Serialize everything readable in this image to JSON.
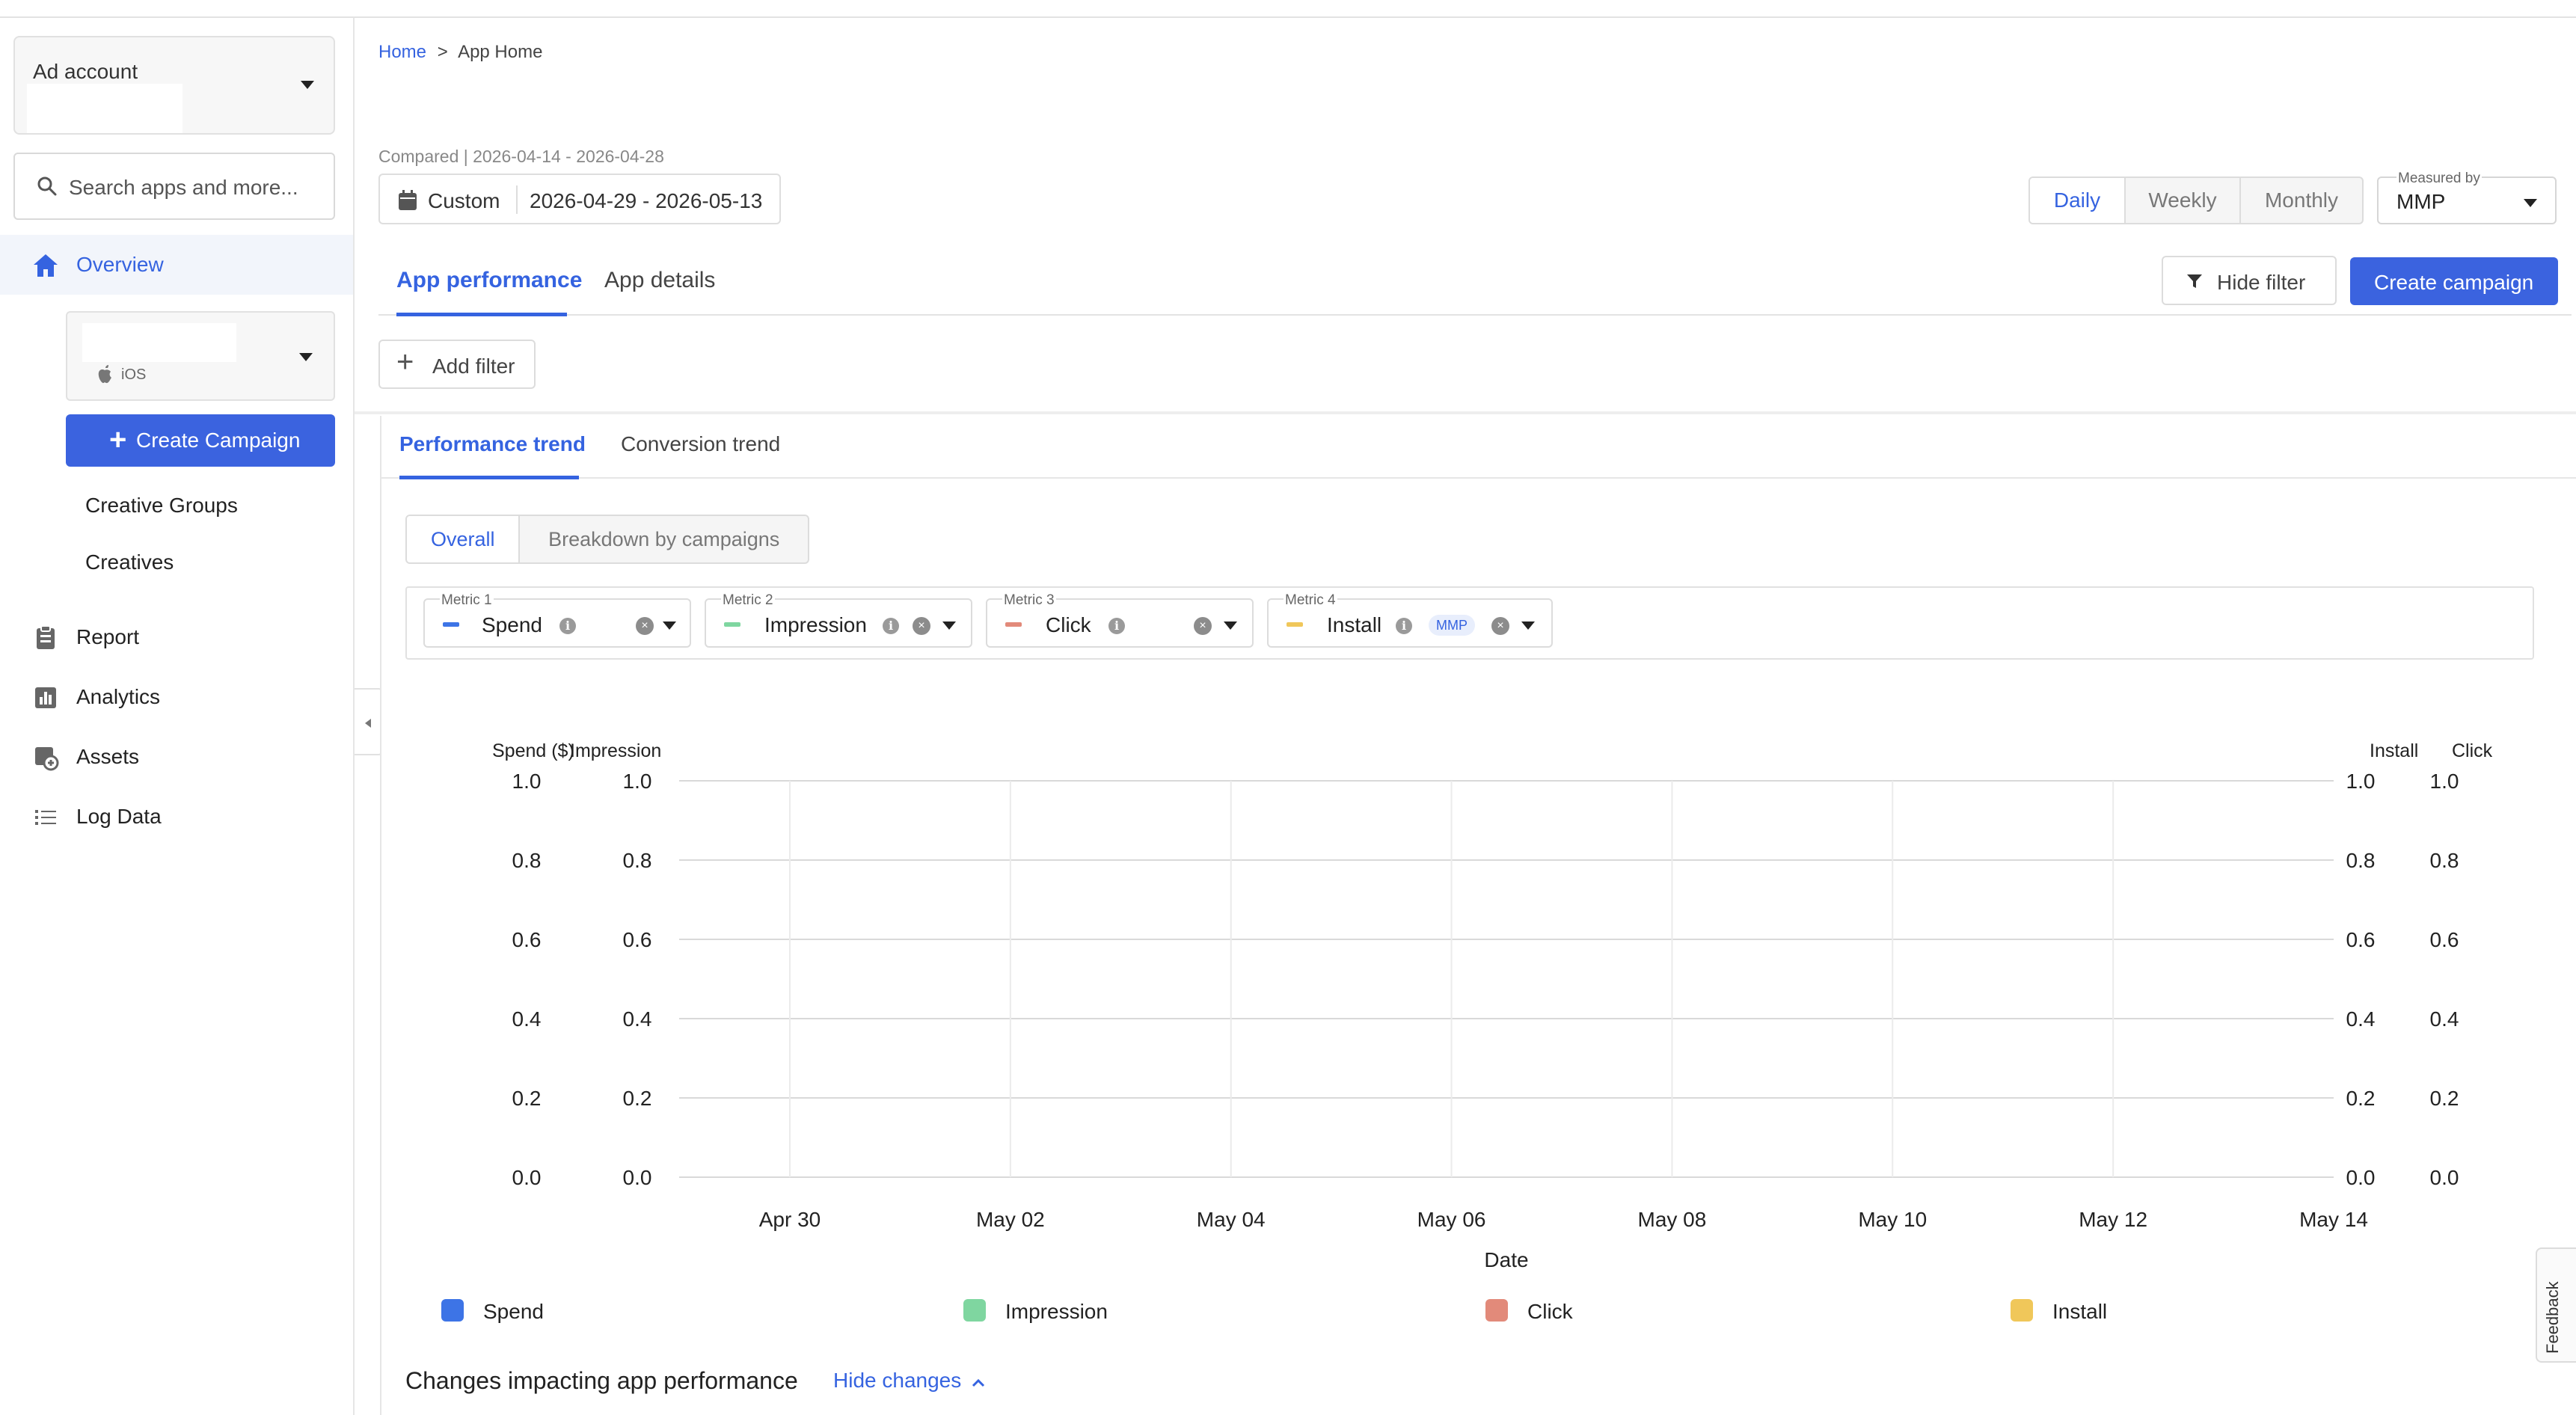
{
  "sidebar": {
    "ad_account_label": "Ad account",
    "search_placeholder": "Search apps and more...",
    "overview_label": "Overview",
    "app_platform": "iOS",
    "create_campaign_label": "Create Campaign",
    "sub_items": [
      "Creative Groups",
      "Creatives"
    ],
    "nav": [
      "Report",
      "Analytics",
      "Assets",
      "Log Data"
    ]
  },
  "breadcrumb": {
    "home": "Home",
    "separator": ">",
    "current": "App Home"
  },
  "date": {
    "compared": "Compared | 2026-04-14 - 2026-04-28",
    "range_type": "Custom",
    "range": "2026-04-29 - 2026-05-13"
  },
  "period": {
    "options": [
      "Daily",
      "Weekly",
      "Monthly"
    ],
    "selected": "Daily"
  },
  "measured_by": {
    "label": "Measured by",
    "value": "MMP"
  },
  "tabs": {
    "items": [
      "App performance",
      "App details"
    ],
    "selected": "App performance"
  },
  "actions": {
    "hide_filter": "Hide filter",
    "create_campaign": "Create campaign",
    "add_filter": "Add filter"
  },
  "subtabs": {
    "items": [
      "Performance trend",
      "Conversion trend"
    ],
    "selected": "Performance trend"
  },
  "segments": {
    "items": [
      "Overall",
      "Breakdown by campaigns"
    ],
    "selected": "Overall"
  },
  "metrics": [
    {
      "label": "Metric 1",
      "name": "Spend",
      "color": "#3d74e6"
    },
    {
      "label": "Metric 2",
      "name": "Impression",
      "color": "#7fd6a0"
    },
    {
      "label": "Metric 3",
      "name": "Click",
      "color": "#e28a7a"
    },
    {
      "label": "Metric 4",
      "name": "Install",
      "color": "#f0c75a",
      "badge": "MMP"
    }
  ],
  "chart_data": {
    "type": "line",
    "xlabel": "Date",
    "x_ticks": [
      "Apr 30",
      "May 02",
      "May 04",
      "May 06",
      "May 08",
      "May 10",
      "May 12",
      "May 14"
    ],
    "axes": [
      {
        "label": "Spend ($)",
        "side": "left",
        "ylim": [
          0,
          1
        ]
      },
      {
        "label": "Impression",
        "side": "left",
        "ylim": [
          0,
          1
        ]
      },
      {
        "label": "Install",
        "side": "right",
        "ylim": [
          0,
          1
        ]
      },
      {
        "label": "Click",
        "side": "right",
        "ylim": [
          0,
          1
        ]
      }
    ],
    "y_ticks": [
      "1.0",
      "0.8",
      "0.6",
      "0.4",
      "0.2",
      "0.0"
    ],
    "series": [
      {
        "name": "Spend",
        "color": "#3d74e6",
        "values": []
      },
      {
        "name": "Impression",
        "color": "#7fd6a0",
        "values": []
      },
      {
        "name": "Click",
        "color": "#e28a7a",
        "values": []
      },
      {
        "name": "Install",
        "color": "#f0c75a",
        "values": []
      }
    ],
    "grid": true,
    "legend_position": "bottom"
  },
  "changes": {
    "title": "Changes impacting app performance",
    "toggle": "Hide changes"
  },
  "feedback": "Feedback"
}
